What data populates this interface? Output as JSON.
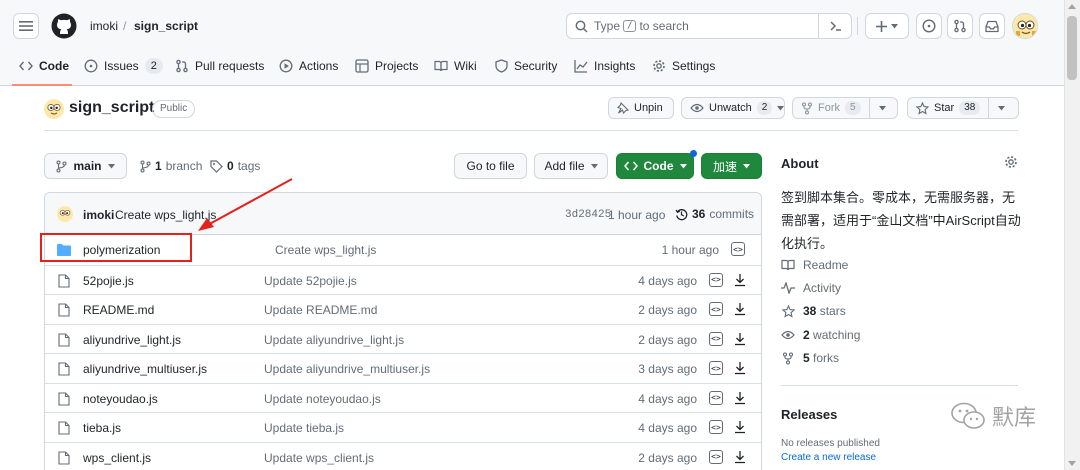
{
  "header": {
    "owner": "imoki",
    "separator": "/",
    "repo": "sign_script",
    "search_prefix": "Type",
    "search_key": "/",
    "search_suffix": "to search",
    "terminal_icon": "command-palette-icon",
    "plus_icon": "plus-icon"
  },
  "tabs": [
    {
      "label": "Code",
      "icon": "code-icon"
    },
    {
      "label": "Issues",
      "icon": "issue-icon",
      "count": "2"
    },
    {
      "label": "Pull requests",
      "icon": "pull-request-icon"
    },
    {
      "label": "Actions",
      "icon": "play-icon"
    },
    {
      "label": "Projects",
      "icon": "table-icon"
    },
    {
      "label": "Wiki",
      "icon": "book-icon"
    },
    {
      "label": "Security",
      "icon": "shield-icon"
    },
    {
      "label": "Insights",
      "icon": "graph-icon"
    },
    {
      "label": "Settings",
      "icon": "gear-icon"
    }
  ],
  "repo": {
    "name": "sign_script",
    "visibility": "Public",
    "unpin_label": "Unpin",
    "unwatch_label": "Unwatch",
    "watch_count": "2",
    "fork_label": "Fork",
    "fork_count": "5",
    "star_label": "Star",
    "star_count": "38"
  },
  "branch_bar": {
    "branch": "main",
    "branches_count": "1",
    "branches_label": "branch",
    "tags_count": "0",
    "tags_label": "tags",
    "go_to_file": "Go to file",
    "add_file": "Add file",
    "code_label": "Code",
    "speedup_label": "加速"
  },
  "latest_commit": {
    "user": "imoki",
    "message": "Create wps_light.js",
    "hash": "3d28425",
    "time": "1 hour ago",
    "commit_count": "36",
    "commit_label": "commits"
  },
  "files": [
    {
      "type": "dir",
      "name": "polymerization",
      "message": "Create wps_light.js",
      "time": "1 hour ago"
    },
    {
      "type": "file",
      "name": "52pojie.js",
      "message": "Update 52pojie.js",
      "time": "4 days ago"
    },
    {
      "type": "file",
      "name": "README.md",
      "message": "Update README.md",
      "time": "2 days ago"
    },
    {
      "type": "file",
      "name": "aliyundrive_light.js",
      "message": "Update aliyundrive_light.js",
      "time": "2 days ago"
    },
    {
      "type": "file",
      "name": "aliyundrive_multiuser.js",
      "message": "Update aliyundrive_multiuser.js",
      "time": "3 days ago"
    },
    {
      "type": "file",
      "name": "noteyoudao.js",
      "message": "Update noteyoudao.js",
      "time": "4 days ago"
    },
    {
      "type": "file",
      "name": "tieba.js",
      "message": "Update tieba.js",
      "time": "4 days ago"
    },
    {
      "type": "file",
      "name": "wps_client.js",
      "message": "Update wps_client.js",
      "time": "2 days ago"
    }
  ],
  "about": {
    "title": "About",
    "description": "签到脚本集合。零成本，无需服务器，无需部署，适用于“金山文档”中AirScript自动化执行。",
    "readme": "Readme",
    "activity": "Activity",
    "stars_count": "38",
    "stars_label": "stars",
    "watching_count": "2",
    "watching_label": "watching",
    "forks_count": "5",
    "forks_label": "forks"
  },
  "releases": {
    "title": "Releases",
    "none_text": "No releases published",
    "create_link": "Create a new release"
  },
  "watermark": {
    "text": "默库"
  },
  "colors": {
    "accent_green": "#1f883d",
    "link_blue": "#0969da",
    "annotation_red": "#e5211d",
    "tab_underline": "#fd8c73"
  }
}
